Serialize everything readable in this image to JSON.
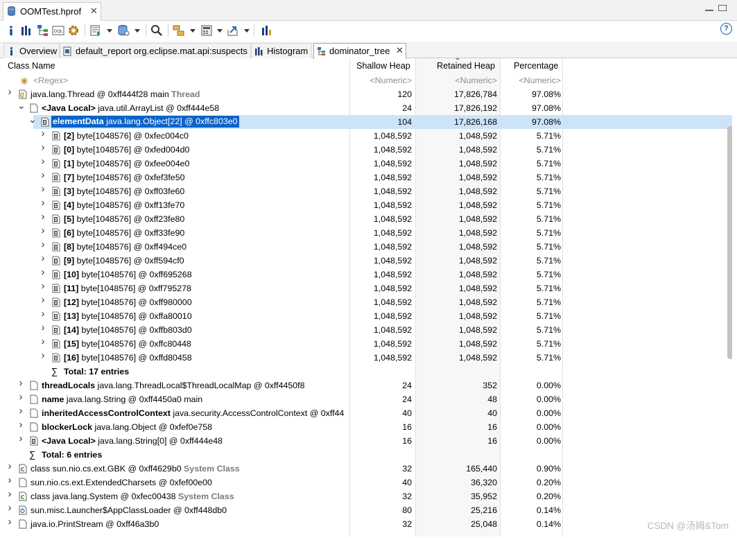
{
  "editor_tab": {
    "title": "OOMTest.hprof",
    "close": "✕"
  },
  "view_tabs": [
    {
      "label": "Overview"
    },
    {
      "label": "default_report org.eclipse.mat.api:suspects"
    },
    {
      "label": "Histogram"
    },
    {
      "label": "dominator_tree",
      "close": "✕"
    }
  ],
  "table": {
    "columns": [
      "Class Name",
      "Shallow Heap",
      "Retained Heap",
      "Percentage"
    ],
    "filter": [
      "<Regex>",
      "<Numeric>",
      "<Numeric>",
      "<Numeric>"
    ],
    "rows": [
      {
        "bold": "",
        "text": "java.lang.Thread @ 0xff444f28  main ",
        "gray": "Thread",
        "shallow": "120",
        "retained": "17,826,784",
        "pct": "97.08%"
      },
      {
        "bold": "<Java Local>",
        "text": " java.util.ArrayList @ 0xff444e58",
        "gray": "",
        "shallow": "24",
        "retained": "17,826,192",
        "pct": "97.08%"
      },
      {
        "bold": "elementData",
        "text": " java.lang.Object[22] @ 0xffc803e0",
        "gray": "",
        "shallow": "104",
        "retained": "17,826,168",
        "pct": "97.08%"
      },
      {
        "bold": "[2]",
        "text": " byte[1048576] @ 0xfec004c0",
        "gray": "",
        "shallow": "1,048,592",
        "retained": "1,048,592",
        "pct": "5.71%"
      },
      {
        "bold": "[0]",
        "text": " byte[1048576] @ 0xfed004d0",
        "gray": "",
        "shallow": "1,048,592",
        "retained": "1,048,592",
        "pct": "5.71%"
      },
      {
        "bold": "[1]",
        "text": " byte[1048576] @ 0xfee004e0",
        "gray": "",
        "shallow": "1,048,592",
        "retained": "1,048,592",
        "pct": "5.71%"
      },
      {
        "bold": "[7]",
        "text": " byte[1048576] @ 0xfef3fe50",
        "gray": "",
        "shallow": "1,048,592",
        "retained": "1,048,592",
        "pct": "5.71%"
      },
      {
        "bold": "[3]",
        "text": " byte[1048576] @ 0xff03fe60",
        "gray": "",
        "shallow": "1,048,592",
        "retained": "1,048,592",
        "pct": "5.71%"
      },
      {
        "bold": "[4]",
        "text": " byte[1048576] @ 0xff13fe70",
        "gray": "",
        "shallow": "1,048,592",
        "retained": "1,048,592",
        "pct": "5.71%"
      },
      {
        "bold": "[5]",
        "text": " byte[1048576] @ 0xff23fe80",
        "gray": "",
        "shallow": "1,048,592",
        "retained": "1,048,592",
        "pct": "5.71%"
      },
      {
        "bold": "[6]",
        "text": " byte[1048576] @ 0xff33fe90",
        "gray": "",
        "shallow": "1,048,592",
        "retained": "1,048,592",
        "pct": "5.71%"
      },
      {
        "bold": "[8]",
        "text": " byte[1048576] @ 0xff494ce0",
        "gray": "",
        "shallow": "1,048,592",
        "retained": "1,048,592",
        "pct": "5.71%"
      },
      {
        "bold": "[9]",
        "text": " byte[1048576] @ 0xff594cf0",
        "gray": "",
        "shallow": "1,048,592",
        "retained": "1,048,592",
        "pct": "5.71%"
      },
      {
        "bold": "[10]",
        "text": " byte[1048576] @ 0xff695268",
        "gray": "",
        "shallow": "1,048,592",
        "retained": "1,048,592",
        "pct": "5.71%"
      },
      {
        "bold": "[11]",
        "text": " byte[1048576] @ 0xff795278",
        "gray": "",
        "shallow": "1,048,592",
        "retained": "1,048,592",
        "pct": "5.71%"
      },
      {
        "bold": "[12]",
        "text": " byte[1048576] @ 0xff980000",
        "gray": "",
        "shallow": "1,048,592",
        "retained": "1,048,592",
        "pct": "5.71%"
      },
      {
        "bold": "[13]",
        "text": " byte[1048576] @ 0xffa80010",
        "gray": "",
        "shallow": "1,048,592",
        "retained": "1,048,592",
        "pct": "5.71%"
      },
      {
        "bold": "[14]",
        "text": " byte[1048576] @ 0xffb803d0",
        "gray": "",
        "shallow": "1,048,592",
        "retained": "1,048,592",
        "pct": "5.71%"
      },
      {
        "bold": "[15]",
        "text": " byte[1048576] @ 0xffc80448",
        "gray": "",
        "shallow": "1,048,592",
        "retained": "1,048,592",
        "pct": "5.71%"
      },
      {
        "bold": "[16]",
        "text": " byte[1048576] @ 0xffd80458",
        "gray": "",
        "shallow": "1,048,592",
        "retained": "1,048,592",
        "pct": "5.71%"
      },
      {
        "bold": "Total: 17 entries",
        "text": "",
        "gray": "",
        "shallow": "",
        "retained": "",
        "pct": ""
      },
      {
        "bold": "threadLocals",
        "text": " java.lang.ThreadLocal$ThreadLocalMap @ 0xff4450f8",
        "gray": "",
        "shallow": "24",
        "retained": "352",
        "pct": "0.00%"
      },
      {
        "bold": "name",
        "text": " java.lang.String @ 0xff4450a0  main",
        "gray": "",
        "shallow": "24",
        "retained": "48",
        "pct": "0.00%"
      },
      {
        "bold": "inheritedAccessControlContext",
        "text": " java.security.AccessControlContext @ 0xff44",
        "gray": "",
        "shallow": "40",
        "retained": "40",
        "pct": "0.00%"
      },
      {
        "bold": "blockerLock",
        "text": " java.lang.Object @ 0xfef0e758",
        "gray": "",
        "shallow": "16",
        "retained": "16",
        "pct": "0.00%"
      },
      {
        "bold": "<Java Local>",
        "text": " java.lang.String[0] @ 0xff444e48",
        "gray": "",
        "shallow": "16",
        "retained": "16",
        "pct": "0.00%"
      },
      {
        "bold": "Total: 6 entries",
        "text": "",
        "gray": "",
        "shallow": "",
        "retained": "",
        "pct": ""
      },
      {
        "bold": "",
        "text": "class sun.nio.cs.ext.GBK @ 0xff4629b0 ",
        "gray": "System Class",
        "shallow": "32",
        "retained": "165,440",
        "pct": "0.90%"
      },
      {
        "bold": "",
        "text": "sun.nio.cs.ext.ExtendedCharsets @ 0xfef00e00",
        "gray": "",
        "shallow": "40",
        "retained": "36,320",
        "pct": "0.20%"
      },
      {
        "bold": "",
        "text": "class java.lang.System @ 0xfec00438 ",
        "gray": "System Class",
        "shallow": "32",
        "retained": "35,952",
        "pct": "0.20%"
      },
      {
        "bold": "",
        "text": "sun.misc.Launcher$AppClassLoader @ 0xff448db0",
        "gray": "",
        "shallow": "80",
        "retained": "25,216",
        "pct": "0.14%"
      },
      {
        "bold": "",
        "text": "java.io.PrintStream @ 0xff46a3b0",
        "gray": "",
        "shallow": "32",
        "retained": "25,048",
        "pct": "0.14%"
      }
    ]
  },
  "watermark": "CSDN @汤姆&Tom"
}
